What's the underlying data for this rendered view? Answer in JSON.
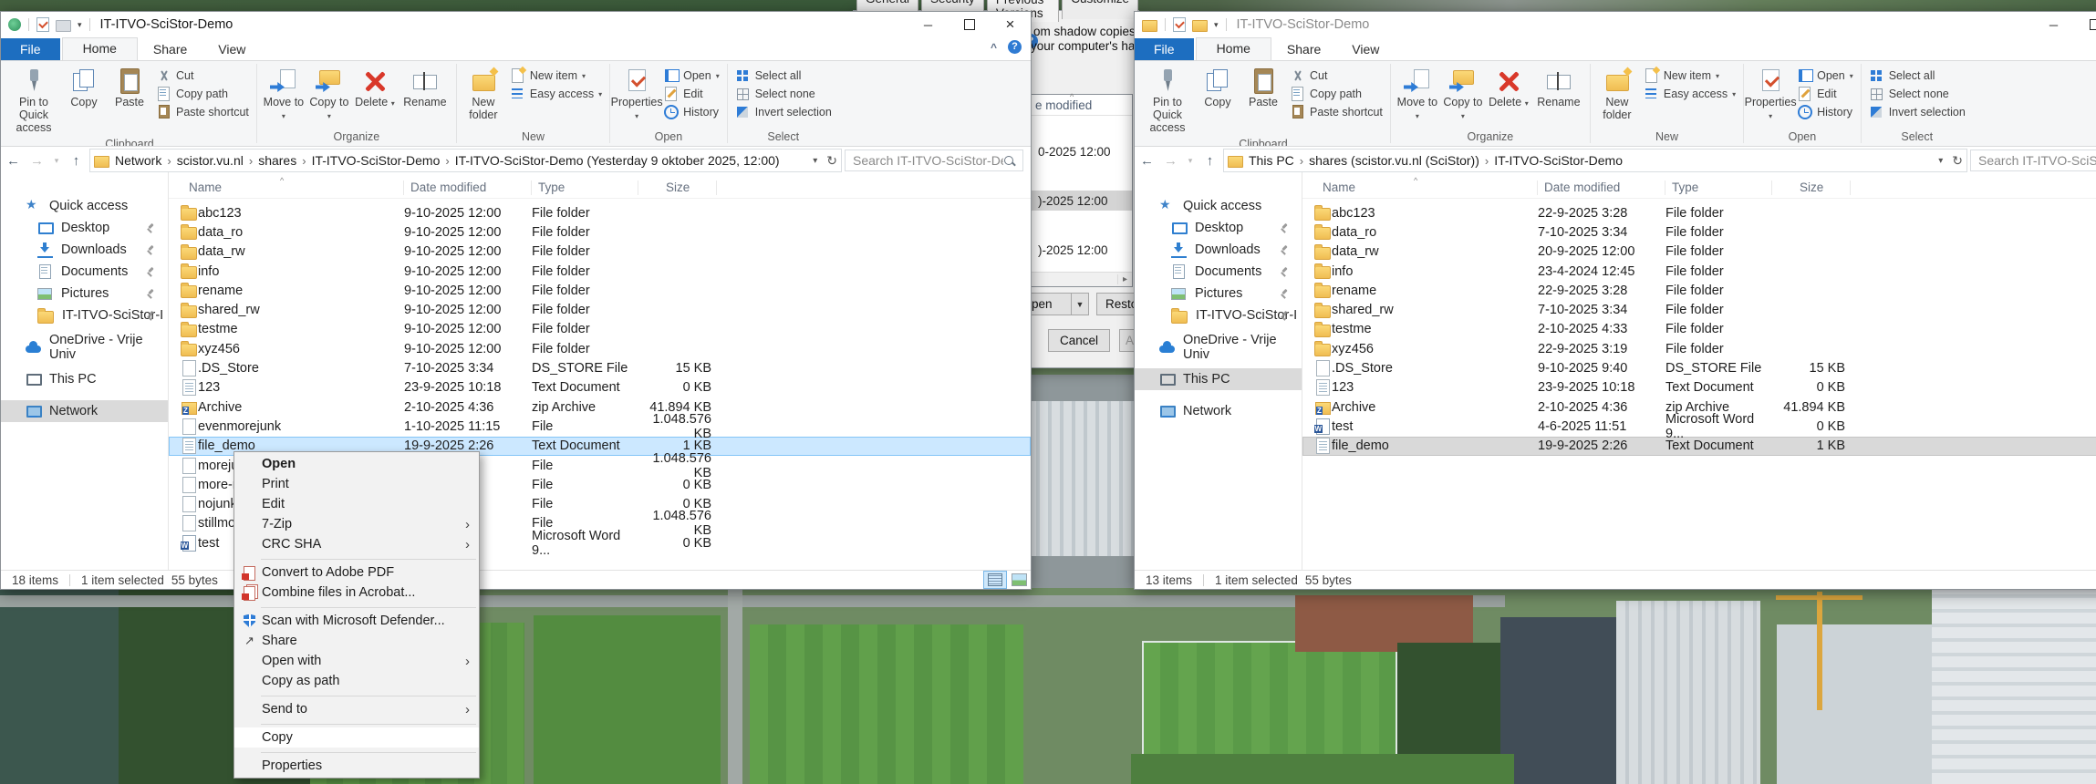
{
  "glyphs": {
    "caret": "▾",
    "caret_down": "▼",
    "crumb": "›",
    "submenu": "›",
    "back": "←",
    "forward": "→",
    "up": "↑",
    "refresh": "↻",
    "minimize": "─",
    "close": "×",
    "collapse": "^",
    "help": "?",
    "sort": "^",
    "scroll_right": "▸"
  },
  "ribbon": {
    "tabs": {
      "file": "File",
      "home": "Home",
      "share": "Share",
      "view": "View"
    },
    "clipboard": {
      "pin": "Pin to Quick access",
      "copy": "Copy",
      "paste": "Paste",
      "cut": "Cut",
      "copy_path": "Copy path",
      "paste_shortcut": "Paste shortcut",
      "label": "Clipboard"
    },
    "organize": {
      "move_to": "Move to",
      "copy_to": "Copy to",
      "delete": "Delete",
      "rename": "Rename",
      "label": "Organize"
    },
    "new_group": {
      "new_folder": "New folder",
      "new_item": "New item",
      "easy_access": "Easy access",
      "label": "New"
    },
    "open_group": {
      "properties": "Properties",
      "open": "Open",
      "edit": "Edit",
      "history": "History",
      "label": "Open"
    },
    "select_group": {
      "all": "Select all",
      "none": "Select none",
      "invert": "Invert selection",
      "label": "Select"
    }
  },
  "columns": [
    "Name",
    "Date modified",
    "Type",
    "Size"
  ],
  "left_window": {
    "title": "IT-ITVO-SciStor-Demo",
    "breadcrumbs": [
      "Network",
      "scistor.vu.nl",
      "shares",
      "IT-ITVO-SciStor-Demo",
      "IT-ITVO-SciStor-Demo (Yesterday 9 oktober 2025, 12:00)"
    ],
    "search_placeholder": "Search IT-ITVO-SciStor-Demo",
    "sidebar": [
      {
        "label": "Quick access",
        "kind": "star",
        "root": true
      },
      {
        "label": "Desktop",
        "kind": "desktop",
        "pinned": true
      },
      {
        "label": "Downloads",
        "kind": "download",
        "pinned": true
      },
      {
        "label": "Documents",
        "kind": "document",
        "pinned": true
      },
      {
        "label": "Pictures",
        "kind": "picture",
        "pinned": true
      },
      {
        "label": "IT-ITVO-SciStor-I",
        "kind": "folder",
        "pinned": true
      },
      {
        "label": "OneDrive - Vrije Univ",
        "kind": "cloud",
        "root": true
      },
      {
        "label": "This PC",
        "kind": "pc",
        "root": true
      },
      {
        "label": "Network",
        "kind": "network",
        "root": true,
        "selected": true
      }
    ],
    "files": [
      {
        "name": "abc123",
        "date": "9-10-2025 12:00",
        "type": "File folder",
        "size": "",
        "kind": "folder"
      },
      {
        "name": "data_ro",
        "date": "9-10-2025 12:00",
        "type": "File folder",
        "size": "",
        "kind": "folder"
      },
      {
        "name": "data_rw",
        "date": "9-10-2025 12:00",
        "type": "File folder",
        "size": "",
        "kind": "folder"
      },
      {
        "name": "info",
        "date": "9-10-2025 12:00",
        "type": "File folder",
        "size": "",
        "kind": "folder"
      },
      {
        "name": "rename",
        "date": "9-10-2025 12:00",
        "type": "File folder",
        "size": "",
        "kind": "folder"
      },
      {
        "name": "shared_rw",
        "date": "9-10-2025 12:00",
        "type": "File folder",
        "size": "",
        "kind": "folder"
      },
      {
        "name": "testme",
        "date": "9-10-2025 12:00",
        "type": "File folder",
        "size": "",
        "kind": "folder"
      },
      {
        "name": "xyz456",
        "date": "9-10-2025 12:00",
        "type": "File folder",
        "size": "",
        "kind": "folder"
      },
      {
        "name": ".DS_Store",
        "date": "7-10-2025 3:34",
        "type": "DS_STORE File",
        "size": "15 KB",
        "kind": "ds"
      },
      {
        "name": "123",
        "date": "23-9-2025 10:18",
        "type": "Text Document",
        "size": "0 KB",
        "kind": "text"
      },
      {
        "name": "Archive",
        "date": "2-10-2025 4:36",
        "type": "zip Archive",
        "size": "41.894 KB",
        "kind": "zip"
      },
      {
        "name": "evenmorejunk",
        "date": "1-10-2025 11:15",
        "type": "File",
        "size": "1.048.576 KB",
        "kind": "file"
      },
      {
        "name": "file_demo",
        "date": "19-9-2025 2:26",
        "type": "Text Document",
        "size": "1 KB",
        "kind": "text",
        "selected": true
      },
      {
        "name": "morejun",
        "date": "",
        "type": "File",
        "size": "1.048.576 KB",
        "kind": "file"
      },
      {
        "name": "more-n",
        "date": "",
        "type": "File",
        "size": "0 KB",
        "kind": "file"
      },
      {
        "name": "nojunk",
        "date": "",
        "type": "File",
        "size": "0 KB",
        "kind": "file"
      },
      {
        "name": "stillmor",
        "date": "",
        "type": "File",
        "size": "1.048.576 KB",
        "kind": "file"
      },
      {
        "name": "test",
        "date": "",
        "type": "Microsoft Word 9...",
        "size": "0 KB",
        "kind": "word"
      }
    ],
    "status": {
      "items": "18 items",
      "selection": "1 item selected",
      "size": "55 bytes"
    }
  },
  "right_window": {
    "title": "IT-ITVO-SciStor-Demo",
    "breadcrumbs": [
      "This PC",
      "shares (scistor.vu.nl (SciStor))",
      "IT-ITVO-SciStor-Demo"
    ],
    "search_placeholder": "Search IT-ITVO-SciStor-De",
    "sidebar": [
      {
        "label": "Quick access",
        "kind": "star",
        "root": true
      },
      {
        "label": "Desktop",
        "kind": "desktop",
        "pinned": true
      },
      {
        "label": "Downloads",
        "kind": "download",
        "pinned": true
      },
      {
        "label": "Documents",
        "kind": "document",
        "pinned": true
      },
      {
        "label": "Pictures",
        "kind": "picture",
        "pinned": true
      },
      {
        "label": "IT-ITVO-SciStor-I",
        "kind": "folder",
        "pinned": true
      },
      {
        "label": "OneDrive - Vrije Univ",
        "kind": "cloud",
        "root": true
      },
      {
        "label": "This PC",
        "kind": "pc",
        "root": true,
        "selected": true
      },
      {
        "label": "Network",
        "kind": "network",
        "root": true
      }
    ],
    "files": [
      {
        "name": "abc123",
        "date": "22-9-2025 3:28",
        "type": "File folder",
        "size": "",
        "kind": "folder"
      },
      {
        "name": "data_ro",
        "date": "7-10-2025 3:34",
        "type": "File folder",
        "size": "",
        "kind": "folder"
      },
      {
        "name": "data_rw",
        "date": "20-9-2025 12:00",
        "type": "File folder",
        "size": "",
        "kind": "folder"
      },
      {
        "name": "info",
        "date": "23-4-2024 12:45",
        "type": "File folder",
        "size": "",
        "kind": "folder"
      },
      {
        "name": "rename",
        "date": "22-9-2025 3:28",
        "type": "File folder",
        "size": "",
        "kind": "folder"
      },
      {
        "name": "shared_rw",
        "date": "7-10-2025 3:34",
        "type": "File folder",
        "size": "",
        "kind": "folder"
      },
      {
        "name": "testme",
        "date": "2-10-2025 4:33",
        "type": "File folder",
        "size": "",
        "kind": "folder"
      },
      {
        "name": "xyz456",
        "date": "22-9-2025 3:19",
        "type": "File folder",
        "size": "",
        "kind": "folder"
      },
      {
        "name": ".DS_Store",
        "date": "9-10-2025 9:40",
        "type": "DS_STORE File",
        "size": "15 KB",
        "kind": "ds"
      },
      {
        "name": "123",
        "date": "23-9-2025 10:18",
        "type": "Text Document",
        "size": "0 KB",
        "kind": "text"
      },
      {
        "name": "Archive",
        "date": "2-10-2025 4:36",
        "type": "zip Archive",
        "size": "41.894 KB",
        "kind": "zip"
      },
      {
        "name": "test",
        "date": "4-6-2025 11:51",
        "type": "Microsoft Word 9...",
        "size": "0 KB",
        "kind": "word"
      },
      {
        "name": "file_demo",
        "date": "19-9-2025 2:26",
        "type": "Text Document",
        "size": "1 KB",
        "kind": "text",
        "selected": true
      }
    ],
    "status": {
      "items": "13 items",
      "selection": "1 item selected",
      "size": "55 bytes"
    }
  },
  "context_menu": {
    "items": [
      {
        "label": "Open",
        "bold": true
      },
      {
        "label": "Print"
      },
      {
        "label": "Edit"
      },
      {
        "label": "7-Zip",
        "submenu": true
      },
      {
        "label": "CRC SHA",
        "submenu": true
      },
      {
        "label": "",
        "sep": true
      },
      {
        "label": "Convert to Adobe PDF",
        "icon": "pdf"
      },
      {
        "label": "Combine files in Acrobat...",
        "icon": "acrobat"
      },
      {
        "label": "",
        "sep": true
      },
      {
        "label": "Scan with Microsoft Defender...",
        "icon": "defender"
      },
      {
        "label": "Share",
        "icon": "share"
      },
      {
        "label": "Open with",
        "submenu": true
      },
      {
        "label": "Copy as path"
      },
      {
        "label": "",
        "sep": true
      },
      {
        "label": "Send to",
        "submenu": true
      },
      {
        "label": "",
        "sep": true
      },
      {
        "label": "Copy",
        "hover": true
      },
      {
        "label": "",
        "sep": true
      },
      {
        "label": "Properties"
      }
    ]
  },
  "dialog": {
    "tabs": [
      "General",
      "Security",
      "Previous Versions",
      "Customize"
    ],
    "line1": "om shadow copies, whi",
    "line2": "your computer's hard d",
    "help": "?",
    "list_header": "e modified",
    "rows": [
      {
        "text": "0-2025 12:00"
      },
      {
        "text": ")-2025 12:00",
        "selected": true
      },
      {
        "text": ")-2025 12:00"
      }
    ],
    "open_btn": "pen",
    "restore_btn": "Restore",
    "cancel_btn": "Cancel",
    "apply_btn": "Apply"
  }
}
